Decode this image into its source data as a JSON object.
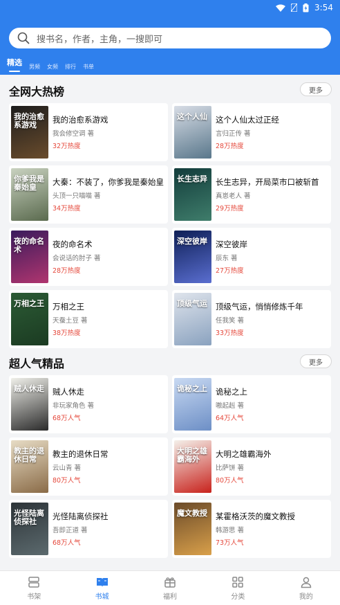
{
  "status": {
    "time": "3:54"
  },
  "search": {
    "placeholder": "搜书名，作者，主角，一搜即可"
  },
  "tabs": [
    "精选",
    "男频",
    "女频",
    "排行",
    "书单"
  ],
  "sections": [
    {
      "title": "全网大热榜",
      "more": "更多",
      "books": [
        {
          "title": "我的治愈系游戏",
          "author": "我会修空调 著",
          "stat": "32万热度",
          "cover_text": "我的治愈系游戏",
          "cover_colors": [
            "#1d1d1d",
            "#6a4c2c"
          ]
        },
        {
          "title": "这个人仙太过正经",
          "author": "言归正传 著",
          "stat": "28万热度",
          "cover_text": "这个人仙",
          "cover_colors": [
            "#d8dde6",
            "#59778b"
          ]
        },
        {
          "title": "大秦：不装了，你爹我是秦始皇",
          "author": "头顶一只喵喵 著",
          "stat": "34万热度",
          "cover_text": "你爹我是秦始皇",
          "cover_colors": [
            "#c9d2c0",
            "#5a6a4e"
          ]
        },
        {
          "title": "长生志异，开局菜市口被斩首",
          "author": "真崽老人 著",
          "stat": "29万热度",
          "cover_text": "长生志异",
          "cover_colors": [
            "#123c3b",
            "#3f7d6b"
          ]
        },
        {
          "title": "夜的命名术",
          "author": "会说话的肘子 著",
          "stat": "28万热度",
          "cover_text": "夜的命名术",
          "cover_colors": [
            "#3a1b5c",
            "#b0356f"
          ]
        },
        {
          "title": "深空彼岸",
          "author": "辰东 著",
          "stat": "27万热度",
          "cover_text": "深空彼岸",
          "cover_colors": [
            "#0e1f56",
            "#5a6ed0"
          ]
        },
        {
          "title": "万相之王",
          "author": "天蚕土豆 著",
          "stat": "38万热度",
          "cover_text": "万相之王",
          "cover_colors": [
            "#2c5b35",
            "#1b3b22"
          ]
        },
        {
          "title": "顶级气运，悄悄修炼千年",
          "author": "任我笑 著",
          "stat": "33万热度",
          "cover_text": "顶级气运",
          "cover_colors": [
            "#dfe4ec",
            "#8aa2bf"
          ]
        }
      ]
    },
    {
      "title": "超人气精品",
      "more": "更多",
      "books": [
        {
          "title": "贼人休走",
          "author": "非玩家角色 著",
          "stat": "68万人气",
          "cover_text": "贼人休走",
          "cover_colors": [
            "#f0f0ea",
            "#2a2a2a"
          ]
        },
        {
          "title": "诡秘之上",
          "author": "嗷起赳 著",
          "stat": "64万人气",
          "cover_text": "诡秘之上",
          "cover_colors": [
            "#c8d9f2",
            "#6d8fc6"
          ]
        },
        {
          "title": "教主的退休日常",
          "author": "云山青 著",
          "stat": "80万人气",
          "cover_text": "教主的退休日常",
          "cover_colors": [
            "#e7dcc5",
            "#8a6b47"
          ]
        },
        {
          "title": "大明之雄霸海外",
          "author": "比萨饼 著",
          "stat": "80万人气",
          "cover_text": "大明之雄霸海外",
          "cover_colors": [
            "#f4f0ea",
            "#c8221c"
          ]
        },
        {
          "title": "光怪陆离侦探社",
          "author": "吾即正道 著",
          "stat": "68万人气",
          "cover_text": "光怪陆离侦探社",
          "cover_colors": [
            "#2d3438",
            "#5c6a6e"
          ]
        },
        {
          "title": "某霍格沃茨的魔文教授",
          "author": "韩游思 著",
          "stat": "73万人气",
          "cover_text": "魔文教授",
          "cover_colors": [
            "#6b4b2a",
            "#d9a04a"
          ]
        }
      ]
    }
  ],
  "bottom_nav": [
    {
      "label": "书架",
      "icon": "bookshelf-icon"
    },
    {
      "label": "书城",
      "icon": "book-open-icon",
      "active": true
    },
    {
      "label": "福利",
      "icon": "gift-icon"
    },
    {
      "label": "分类",
      "icon": "grid-icon"
    },
    {
      "label": "我的",
      "icon": "user-icon"
    }
  ],
  "colors": {
    "primary": "#2f80ed",
    "heat": "#e5483b"
  }
}
